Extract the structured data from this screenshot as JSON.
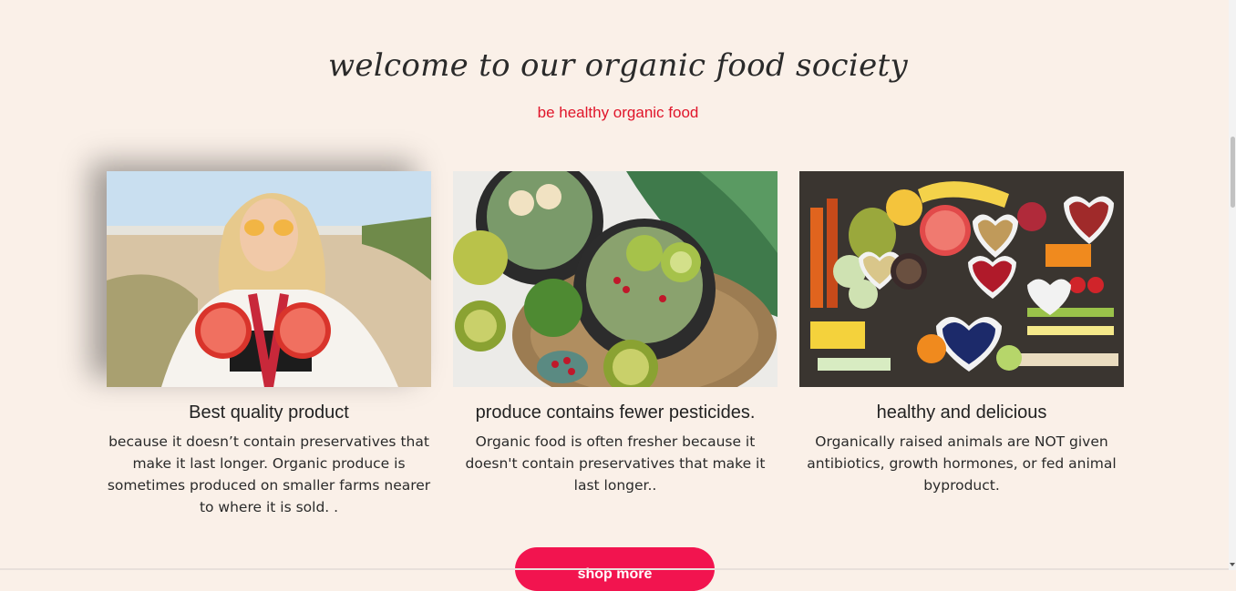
{
  "header": {
    "title": "welcome to our organic food society",
    "subtitle": "be healthy organic food"
  },
  "cards": [
    {
      "image": "woman-holding-grapefruit-on-beach",
      "title": "Best quality product",
      "text": "because it doesn’t contain preservatives that make it last longer. Organic produce is sometimes produced on smaller farms nearer to where it is sold. ."
    },
    {
      "image": "smoothie-bowls-with-kiwi-and-pomegranate",
      "title": "produce contains fewer pesticides.",
      "text": "Organic food is often fresher because it doesn't contain preservatives that make it last longer.."
    },
    {
      "image": "heart-bowls-of-vegetables-fruits-and-nuts",
      "title": "healthy and delicious",
      "text": "Organically raised animals are NOT given antibiotics, growth hormones, or fed animal byproduct."
    }
  ],
  "cta": {
    "label": "shop more"
  },
  "colors": {
    "background": "#faf0e8",
    "subtitle": "#e0152a",
    "button": "#f2144f"
  }
}
